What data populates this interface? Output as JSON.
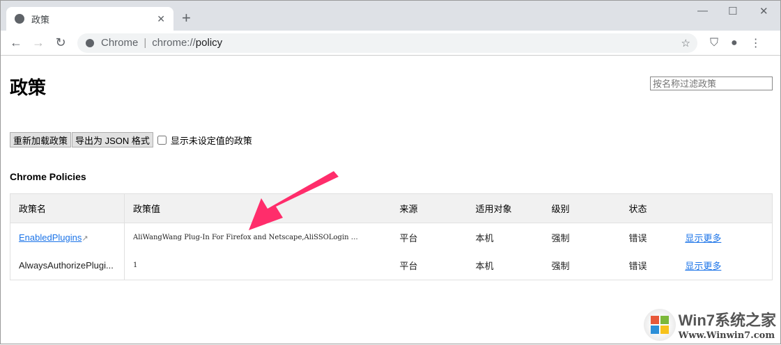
{
  "tab": {
    "title": "政策"
  },
  "omnibox": {
    "site": "Chrome",
    "url_scheme": "chrome://",
    "url_path": "policy"
  },
  "page": {
    "title": "政策",
    "filter_placeholder": "按名称过滤政策",
    "reload_button": "重新加载政策",
    "export_button": "导出为 JSON 格式",
    "show_unset_label": "显示未设定值的政策",
    "section_title": "Chrome Policies"
  },
  "table": {
    "headers": [
      "政策名",
      "政策值",
      "来源",
      "适用对象",
      "级别",
      "状态"
    ],
    "rows": [
      {
        "name": "EnabledPlugins",
        "value": "AliWangWang Plug-In For Firefox and Netscape,AliSSOLogin …",
        "source": "平台",
        "scope": "本机",
        "level": "强制",
        "status": "错误",
        "more": "显示更多"
      },
      {
        "name": "AlwaysAuthorizePlugi...",
        "value": "1",
        "source": "平台",
        "scope": "本机",
        "level": "强制",
        "status": "错误",
        "more": "显示更多"
      }
    ]
  },
  "watermark": {
    "brand": "Win7系统之家",
    "url": "Www.Winwin7.com"
  },
  "colors": {
    "arrow": "#ff2d6b",
    "link": "#1a73e8"
  }
}
